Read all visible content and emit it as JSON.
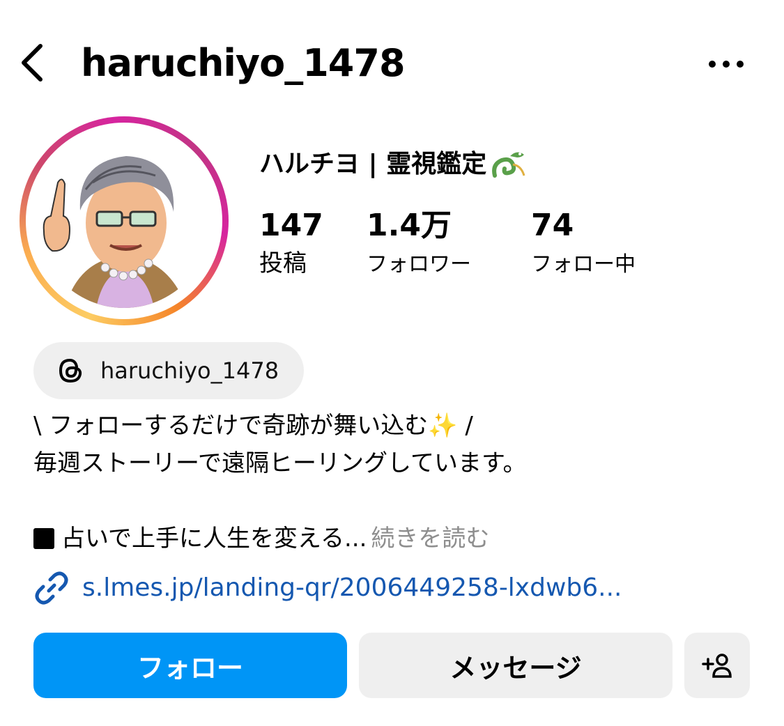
{
  "header": {
    "username": "haruchiyo_1478",
    "back_icon": "chevron-left-icon",
    "more_icon": "more-horizontal-icon"
  },
  "profile": {
    "display_name": "ハルチヨ | 霊視鑑定",
    "display_emoji_icon": "dragon-icon",
    "avatar_icon": "avatar-illustration-icon",
    "ring_colors": [
      "#fccc63",
      "#f58529",
      "#d6249f",
      "#c13584"
    ]
  },
  "stats": [
    {
      "value": "147",
      "label": "投稿"
    },
    {
      "value": "1.4万",
      "label": "フォロワー"
    },
    {
      "value": "74",
      "label": "フォロー中"
    }
  ],
  "threads": {
    "handle": "haruchiyo_1478",
    "icon": "threads-icon"
  },
  "bio": {
    "line1": "\\ フォローするだけで奇跡が舞い込む✨ /",
    "line2": "毎週ストーリーで遠隔ヒーリングしています。",
    "line3": "占いで上手に人生を変える...",
    "more_label": "続きを読む"
  },
  "link": {
    "text": "s.lmes.jp/landing-qr/2006449258-lxdwb6...",
    "icon": "link-icon",
    "color": "#1558b0"
  },
  "actions": {
    "follow_label": "フォロー",
    "message_label": "メッセージ",
    "add_user_icon": "add-user-icon",
    "accent": "#0095f6"
  }
}
